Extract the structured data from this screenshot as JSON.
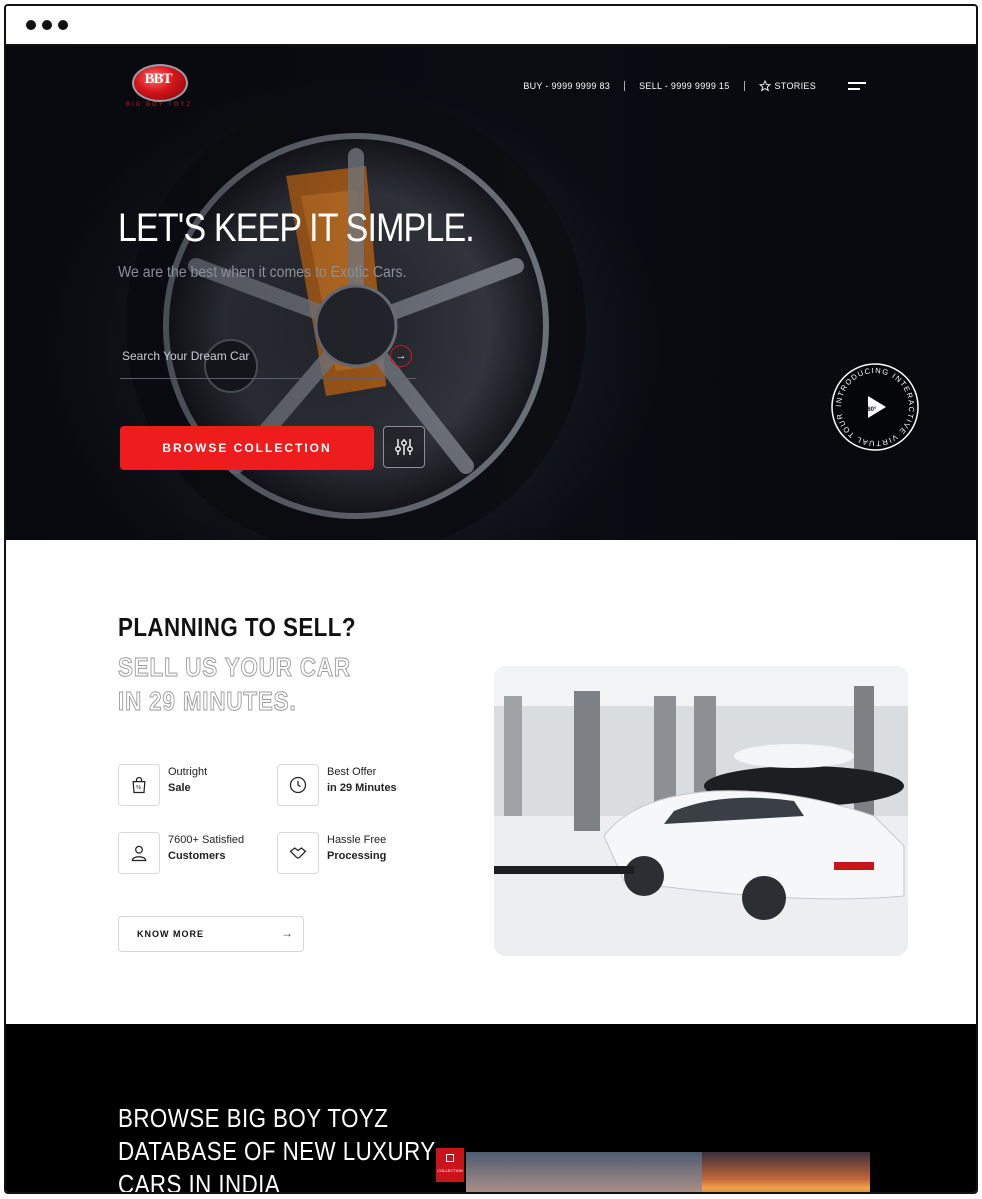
{
  "browser": {
    "dots": 3
  },
  "brand": {
    "logo_text": "BBT",
    "logo_sub": "BIG BOY TOYZ"
  },
  "nav": {
    "buy": "BUY - 9999 9999 83",
    "sell": "SELL - 9999 9999 15",
    "stories": "STORIES"
  },
  "hero": {
    "title": "LET'S KEEP IT SIMPLE.",
    "subtitle": "We are the best when it comes to Exotic Cars.",
    "search_placeholder": "Search Your Dream Car",
    "browse_label": "BROWSE COLLECTION",
    "tour_text": "INTRODUCING INTERACTIVE VIRTUAL TOUR",
    "tour_badge": "360°"
  },
  "sell": {
    "heading": "PLANNING TO SELL?",
    "line1": "SELL US YOUR CAR",
    "line2": "IN 29 MINUTES.",
    "features": [
      {
        "top": "Outright",
        "bottom": "Sale",
        "icon": "bag-percent-icon"
      },
      {
        "top": "Best Offer",
        "bottom": "in 29 Minutes",
        "icon": "clock-icon"
      },
      {
        "top": "7600+ Satisfied",
        "bottom": "Customers",
        "icon": "customer-icon"
      },
      {
        "top": "Hassle Free",
        "bottom": "Processing",
        "icon": "handshake-icon"
      }
    ],
    "know_more": "KNOW MORE"
  },
  "database": {
    "line1": "BROWSE BIG BOY TOYZ",
    "line2": "DATABASE OF NEW LUXURY",
    "line3": "CARS IN INDIA",
    "collection_tag": "COLLECTION"
  },
  "colors": {
    "accent": "#ee1c1c",
    "hero_bg": "#0b0d14",
    "dark": "#000000"
  }
}
